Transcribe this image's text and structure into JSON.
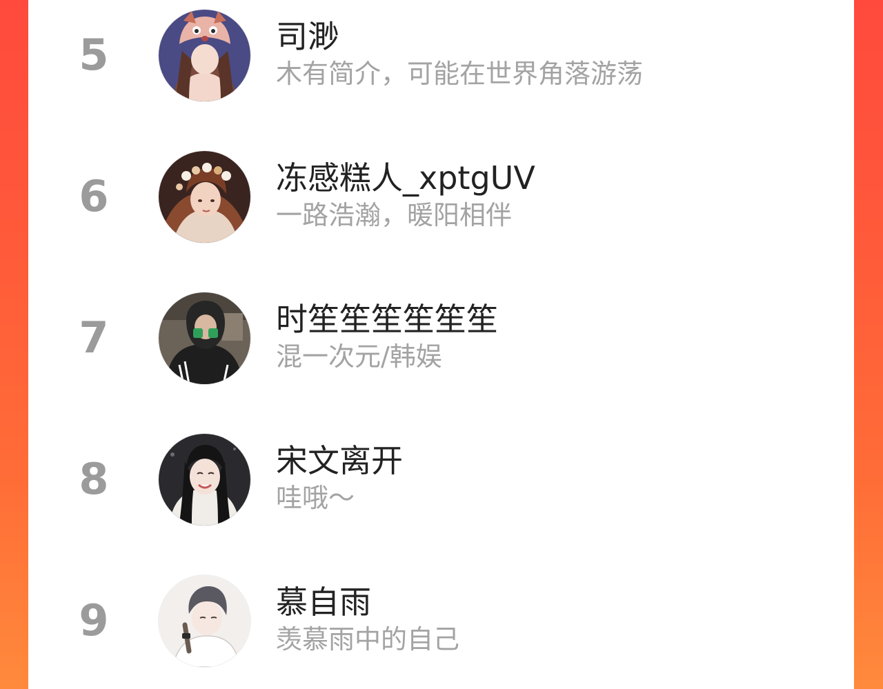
{
  "colors": {
    "background_gradient_top": "#ff4a3d",
    "background_gradient_bottom": "#ff8a3c",
    "panel": "#ffffff",
    "rank": "#9b9b9b",
    "name": "#222222",
    "bio": "#a3a3a3"
  },
  "ranking": {
    "items": [
      {
        "rank": "5",
        "name": "司渺",
        "bio": "木有简介，可能在世界角落游荡",
        "avatar": "avatar-girl-fox-hat"
      },
      {
        "rank": "6",
        "name": "冻感糕人_xptgUV",
        "bio": "一路浩瀚，暖阳相伴",
        "avatar": "avatar-girl-flower-crown"
      },
      {
        "rank": "7",
        "name": "时笙笙笙笙笙笙",
        "bio": "混一次元/韩娱",
        "avatar": "avatar-hooded-person"
      },
      {
        "rank": "8",
        "name": "宋文离开",
        "bio": "哇哦～",
        "avatar": "avatar-smiling-girl"
      },
      {
        "rank": "9",
        "name": "慕自雨",
        "bio": "羡慕雨中的自己",
        "avatar": "avatar-sketch-boy"
      }
    ]
  }
}
